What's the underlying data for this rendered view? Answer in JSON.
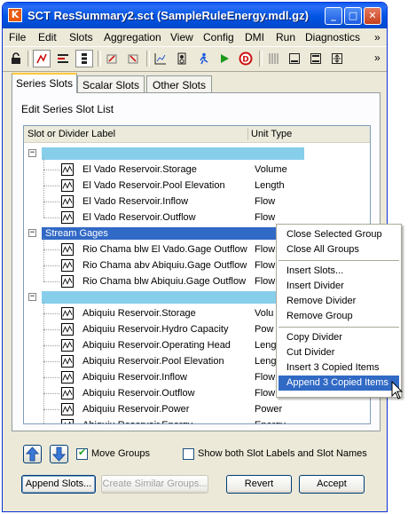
{
  "window": {
    "title": "SCT ResSummary2.sct (SampleRuleEnergy.mdl.gz)",
    "app_icon_glyph": "K",
    "min_label": "_",
    "max_label": "□",
    "close_label": "✕"
  },
  "menu": {
    "items": [
      "File",
      "Edit",
      "Slots",
      "Aggregation",
      "View",
      "Config",
      "DMI",
      "Run",
      "Diagnostics"
    ],
    "overflow": "»"
  },
  "toolbar": {
    "overflow": "»",
    "icons": [
      "lock-icon",
      "series-slot-icon",
      "column-icon",
      "row-icon",
      "slot-add-icon",
      "slot-remove-icon",
      "plot-icon",
      "aggregation-icon",
      "run-person-icon",
      "play-icon",
      "stop-icon",
      "grid-icon",
      "window-icon",
      "window-alt-icon",
      "resize-icon"
    ]
  },
  "tabs": [
    "Series Slots",
    "Scalar Slots",
    "Other Slots"
  ],
  "panel": {
    "title": "Edit Series Slot List",
    "columns": [
      "Slot or Divider Label",
      "Unit Type"
    ]
  },
  "groups": [
    {
      "label": "",
      "selected": false,
      "slots": [
        {
          "name": "El Vado Reservoir.Storage",
          "unit": "Volume"
        },
        {
          "name": "El Vado Reservoir.Pool Elevation",
          "unit": "Length"
        },
        {
          "name": "El Vado Reservoir.Inflow",
          "unit": "Flow"
        },
        {
          "name": "El Vado Reservoir.Outflow",
          "unit": "Flow"
        }
      ]
    },
    {
      "label": "Stream Gages",
      "selected": true,
      "slots": [
        {
          "name": "Rio Chama blw El Vado.Gage Outflow",
          "unit": "Flow"
        },
        {
          "name": "Rio Chama abv Abiquiu.Gage Outflow",
          "unit": "Flow"
        },
        {
          "name": "Rio Chama blw Abiquiu.Gage Outflow",
          "unit": "Flow"
        }
      ]
    },
    {
      "label": "",
      "selected": false,
      "slots": [
        {
          "name": "Abiquiu Reservoir.Storage",
          "unit": "Volu"
        },
        {
          "name": "Abiquiu Reservoir.Hydro Capacity",
          "unit": "Pow"
        },
        {
          "name": "Abiquiu Reservoir.Operating Head",
          "unit": "Leng"
        },
        {
          "name": "Abiquiu Reservoir.Pool Elevation",
          "unit": "Leng"
        },
        {
          "name": "Abiquiu Reservoir.Inflow",
          "unit": "Flow"
        },
        {
          "name": "Abiquiu Reservoir.Outflow",
          "unit": "Flow"
        },
        {
          "name": "Abiquiu Reservoir.Power",
          "unit": "Power"
        },
        {
          "name": "Abiquiu Reservoir.Energy",
          "unit": "Energy"
        }
      ]
    }
  ],
  "controls": {
    "move_groups_label": "Move Groups",
    "move_groups_checked": true,
    "show_both_label": "Show both Slot Labels and Slot Names",
    "show_both_checked": false,
    "append_slots": "Append Slots...",
    "create_similar": "Create Similar Groups...",
    "revert": "Revert",
    "accept": "Accept"
  },
  "context_menu": {
    "sections": [
      [
        "Close Selected Group",
        "Close All Groups"
      ],
      [
        "Insert Slots...",
        "Insert Divider",
        "Remove Divider",
        "Remove Group"
      ],
      [
        "Copy Divider",
        "Cut Divider",
        "Insert 3 Copied Items",
        "Append 3 Copied Items"
      ]
    ],
    "highlighted": "Append 3 Copied Items"
  },
  "colors": {
    "divider": "#87ceeb",
    "divider_selected": "#3169c6",
    "highlight": "#316ac5"
  }
}
